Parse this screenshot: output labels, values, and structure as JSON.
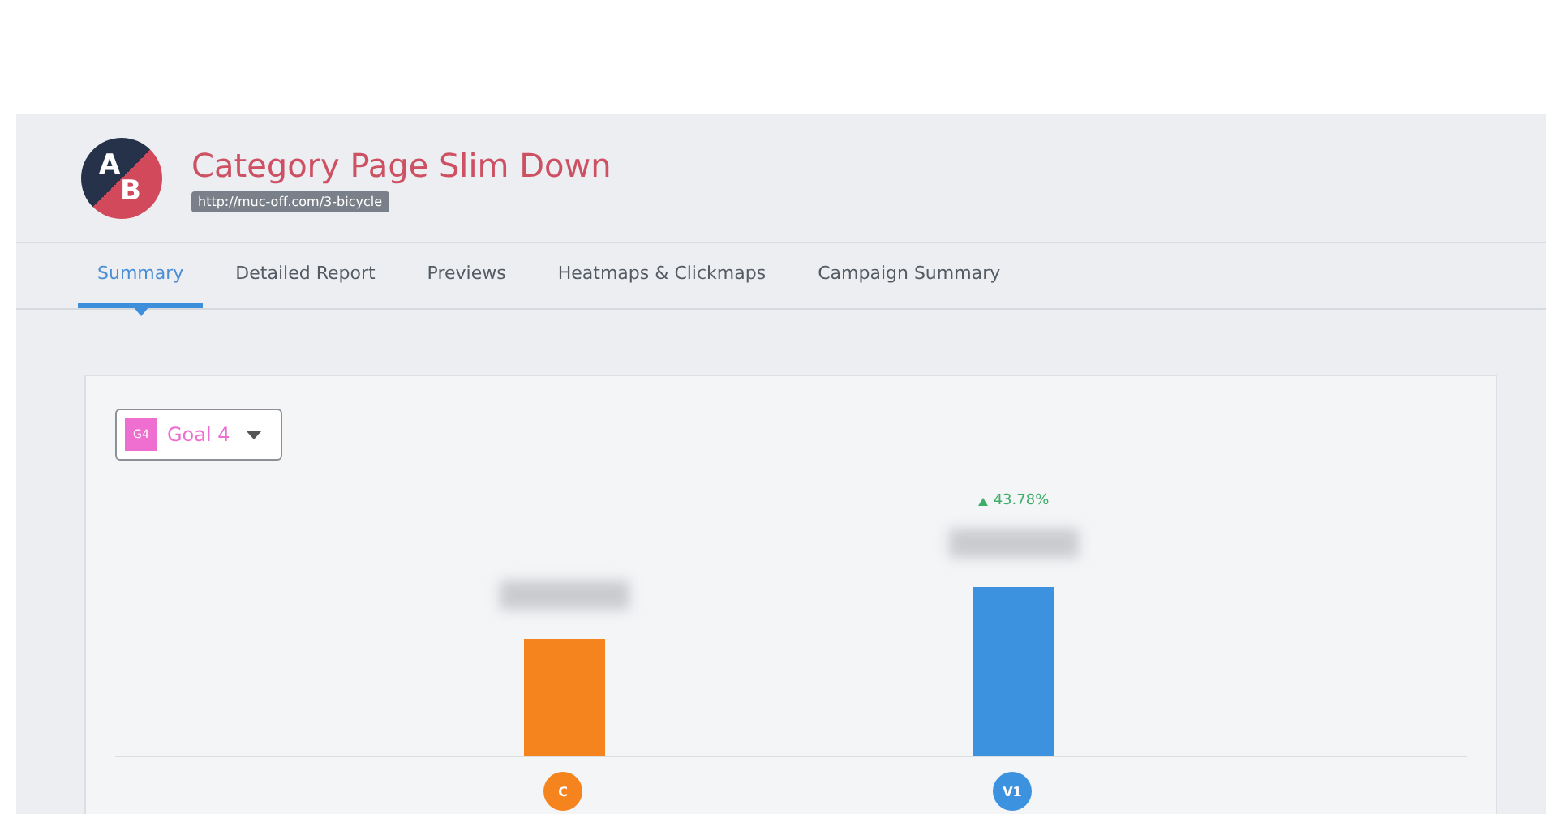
{
  "header": {
    "avatar": {
      "top": "A",
      "bottom": "B"
    },
    "title": "Category Page Slim Down",
    "url": "http://muc-off.com/3-bicycle"
  },
  "tabs": [
    {
      "label": "Summary",
      "selected": true
    },
    {
      "label": "Detailed Report",
      "selected": false
    },
    {
      "label": "Previews",
      "selected": false
    },
    {
      "label": "Heatmaps & Clickmaps",
      "selected": false
    },
    {
      "label": "Campaign Summary",
      "selected": false
    }
  ],
  "goal_selector": {
    "badge": "G4",
    "label": "Goal 4",
    "color": "#ee6fcf"
  },
  "variations": [
    {
      "badge": "C",
      "color": "#f5841f"
    },
    {
      "badge": "V1",
      "color": "#3d92e0",
      "change": "43.78%"
    }
  ]
}
